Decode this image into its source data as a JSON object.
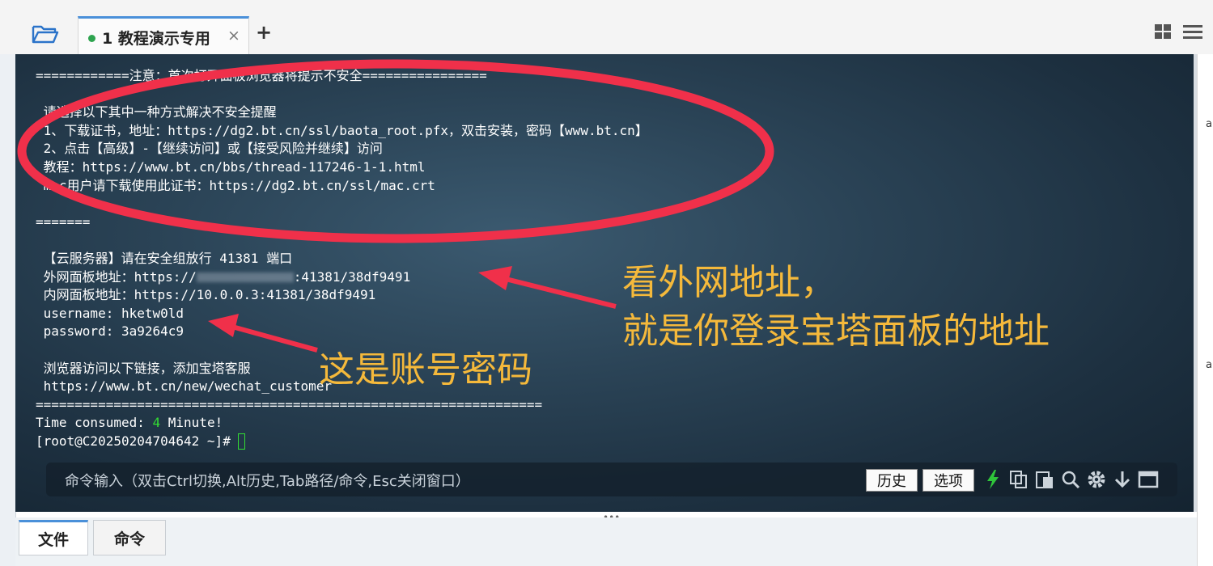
{
  "tab": {
    "title": "1 教程演示专用",
    "close": "×",
    "add": "+"
  },
  "terminal": {
    "lines": [
      "============注意：首次打开面板浏览器将提示不安全================",
      "",
      " 请选择以下其中一种方式解决不安全提醒",
      " 1、下载证书，地址：https://dg2.bt.cn/ssl/baota_root.pfx，双击安装，密码【www.bt.cn】",
      " 2、点击【高级】-【继续访问】或【接受风险并继续】访问",
      " 教程：https://www.bt.cn/bbs/thread-117246-1-1.html",
      " mac用户请下载使用此证书：https://dg2.bt.cn/ssl/mac.crt",
      "",
      "=======",
      "",
      " 【云服务器】请在安全组放行 41381 端口",
      " 外网面板地址：https://",
      " 内网面板地址：https://10.0.0.3:41381/38df9491",
      " username: hketw0ld",
      " password: 3a9264c9",
      "",
      " 浏览器访问以下链接，添加宝塔客服",
      " https://www.bt.cn/new/wechat_customer",
      "=================================================================",
      "Time consumed: ",
      "[root@C20250204704642 ~]# "
    ],
    "external_suffix": ":41381/38df9491",
    "time_value": "4",
    "time_unit": " Minute!"
  },
  "annotations": {
    "line1": "看外网地址，",
    "line2": "就是你登录宝塔面板的地址",
    "line3": "这是账号密码",
    "color": "#f5b93b",
    "ellipse_color": "#f0304a"
  },
  "command_bar": {
    "placeholder": "命令输入（双击Ctrl切换,Alt历史,Tab路径/命令,Esc关闭窗口）",
    "history": "历史",
    "options": "选项"
  },
  "bottom_tabs": {
    "file": "文件",
    "command": "命令"
  },
  "right_strip": {
    "mark": "a"
  },
  "colors": {
    "terminal_bg": "#2b4457",
    "prompt_green": "#33dd33",
    "accent": "#4a90d9"
  }
}
